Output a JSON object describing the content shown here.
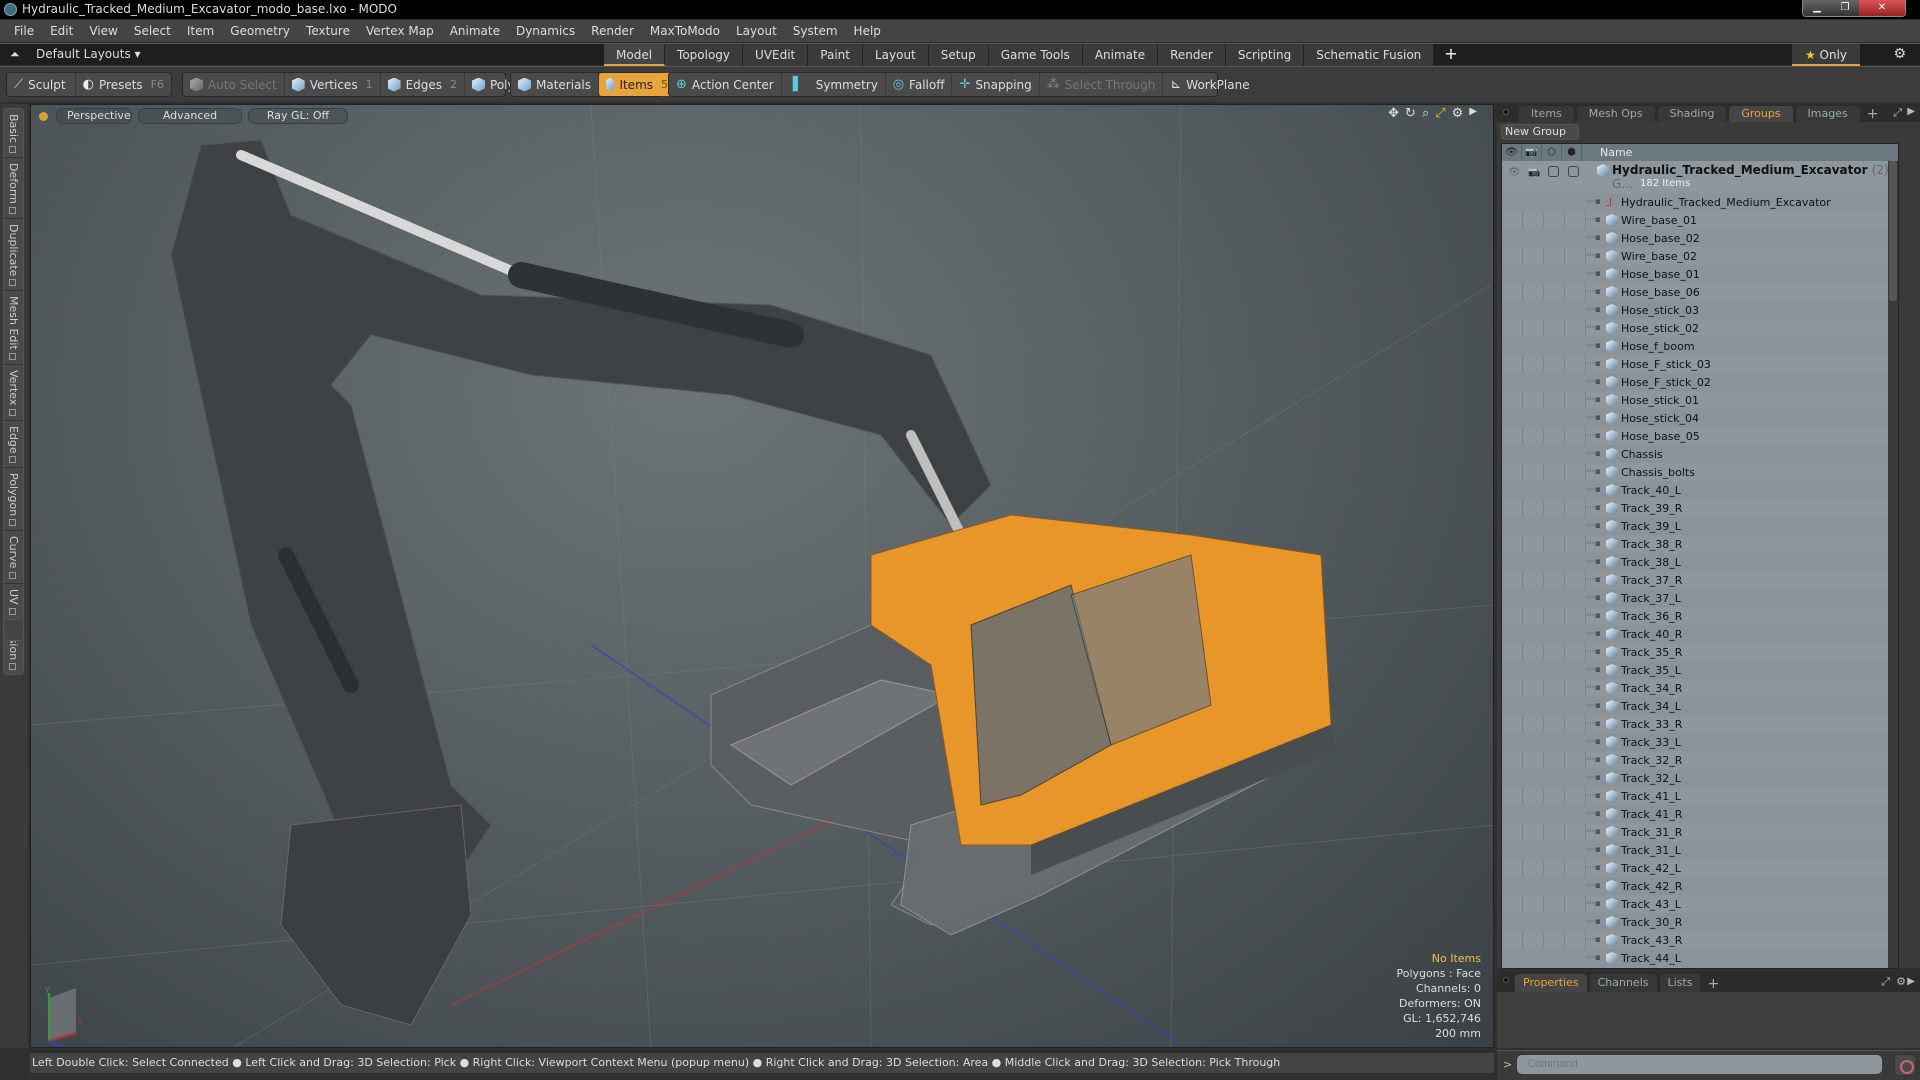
{
  "window": {
    "title": "Hydraulic_Tracked_Medium_Excavator_modo_base.lxo - MODO",
    "controls": [
      "minimize",
      "restore",
      "close"
    ]
  },
  "menu": [
    "File",
    "Edit",
    "View",
    "Select",
    "Item",
    "Geometry",
    "Texture",
    "Vertex Map",
    "Animate",
    "Dynamics",
    "Render",
    "MaxToModo",
    "Layout",
    "System",
    "Help"
  ],
  "layoutbar": {
    "layouts_label": "Default Layouts ▾",
    "tabs": [
      "Model",
      "Topology",
      "UVEdit",
      "Paint",
      "Layout",
      "Setup",
      "Game Tools",
      "Animate",
      "Render",
      "Scripting",
      "Schematic Fusion"
    ],
    "active_tab": "Model",
    "add_label": "+",
    "only_label": "Only"
  },
  "toolbar": {
    "sculpt": "Sculpt",
    "presets": "Presets",
    "presets_key": "F6",
    "auto_select": "Auto Select",
    "vertices": "Vertices",
    "vertices_key": "1",
    "edges": "Edges",
    "edges_key": "2",
    "polygons": "Polygons",
    "materials": "Materials",
    "items": "Items",
    "items_key": "5",
    "action_center": "Action Center",
    "symmetry": "Symmetry",
    "falloff": "Falloff",
    "snapping": "Snapping",
    "select_through": "Select Through",
    "workplane": "WorkPlane"
  },
  "left_tabs": [
    "Basic",
    "Deform",
    "Duplicate",
    "Mesh Edit",
    "Vertex",
    "Edge",
    "Polygon",
    "Curve",
    "UV",
    "Fusion"
  ],
  "viewport": {
    "view_mode": "Perspective",
    "shading": "Advanced",
    "raygl": "Ray GL: Off",
    "info": {
      "selection": "No Items",
      "polygons": "Polygons : Face",
      "channels": "Channels: 0",
      "deformers": "Deformers: ON",
      "gl": "GL: 1,652,746",
      "scale": "200 mm"
    },
    "axis_labels": {
      "x": "X",
      "y": "Y",
      "z": "Z"
    }
  },
  "statusbar": "Left Double Click: Select Connected ● Left Click and Drag: 3D Selection: Pick ● Right Click: Viewport Context Menu (popup menu) ● Right Click and Drag: 3D Selection: Area ● Middle Click and Drag: 3D Selection: Pick Through",
  "right_panel": {
    "tabs": [
      "Items",
      "Mesh Ops",
      "Shading",
      "Groups",
      "Images"
    ],
    "active_tab": "Groups",
    "new_group": "New Group",
    "column_name": "Name",
    "group": {
      "name": "Hydraulic_Tracked_Medium_Excavator",
      "count": "(2) : G...",
      "subtitle": "182 Items"
    },
    "items": [
      "Hydraulic_Tracked_Medium_Excavator",
      "Wire_base_01",
      "Hose_base_02",
      "Wire_base_02",
      "Hose_base_01",
      "Hose_base_06",
      "Hose_stick_03",
      "Hose_stick_02",
      "Hose_f_boom",
      "Hose_F_stick_03",
      "Hose_F_stick_02",
      "Hose_stick_01",
      "Hose_stick_04",
      "Hose_base_05",
      "Chassis",
      "Chassis_bolts",
      "Track_40_L",
      "Track_39_R",
      "Track_39_L",
      "Track_38_R",
      "Track_38_L",
      "Track_37_R",
      "Track_37_L",
      "Track_36_R",
      "Track_40_R",
      "Track_35_R",
      "Track_35_L",
      "Track_34_R",
      "Track_34_L",
      "Track_33_R",
      "Track_33_L",
      "Track_32_R",
      "Track_32_L",
      "Track_41_L",
      "Track_41_R",
      "Track_31_R",
      "Track_31_L",
      "Track_42_L",
      "Track_42_R",
      "Track_43_L",
      "Track_30_R",
      "Track_43_R",
      "Track_44_L"
    ]
  },
  "props_panel": {
    "tabs": [
      "Properties",
      "Channels",
      "Lists"
    ],
    "active_tab": "Properties"
  },
  "command": {
    "prompt": ">",
    "placeholder": "Command"
  },
  "colors": {
    "accent": "#e8a33a",
    "excavator_body": "#e8962a",
    "viewport_bg": "#575e62"
  }
}
